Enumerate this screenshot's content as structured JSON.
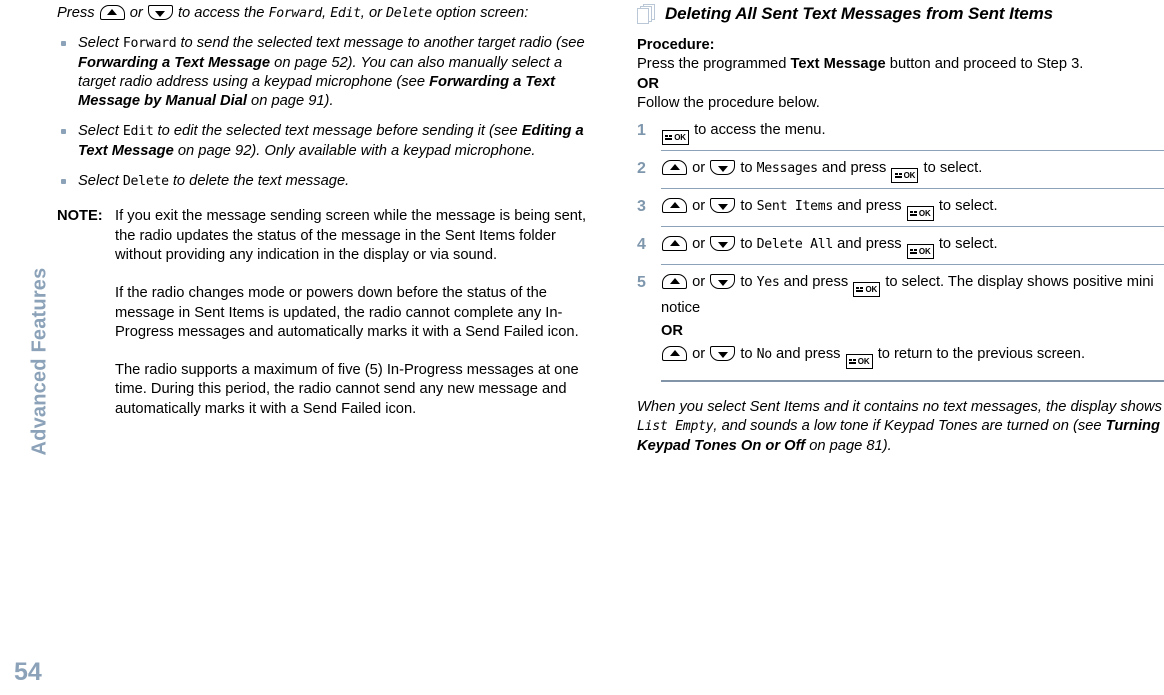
{
  "sidebar": {
    "chapter_title": "Advanced Features",
    "page_number": "54",
    "accent_color": "#8ba2b8"
  },
  "left_column": {
    "intro": {
      "text_a": "Press ",
      "text_b": " or ",
      "text_c": " to access the ",
      "lcd_forward": "Forward",
      "text_d": ", ",
      "lcd_edit": "Edit",
      "text_e": ", or ",
      "lcd_delete": "Delete",
      "text_f": " option screen:"
    },
    "bullets": [
      {
        "select_word": "Select ",
        "lcd": "Forward",
        "body_1": " to send the selected text message to another target radio (see ",
        "bold_1": "Forwarding a Text Message",
        "body_2": " on page 52). You can also manually select a target radio address using a keypad microphone (see ",
        "bold_2": "Forwarding a Text Message by Manual Dial",
        "body_3": " on page 91)."
      },
      {
        "select_word": "Select ",
        "lcd": "Edit",
        "body_1": " to edit the selected text message before sending it (see ",
        "bold_1": "Editing a Text Message",
        "body_2": " on page 92). Only available with a keypad microphone.",
        "bold_2": "",
        "body_3": ""
      },
      {
        "select_word": "Select ",
        "lcd": "Delete",
        "body_1": " to delete the text message.",
        "bold_1": "",
        "body_2": "",
        "bold_2": "",
        "body_3": ""
      }
    ],
    "note": {
      "label": "NOTE:",
      "paragraphs": [
        "If you exit the message sending screen while the message is being sent, the radio updates the status of the message in the Sent Items folder without providing any indication in the display or via sound.",
        "If the radio changes mode or powers down before the status of the message in Sent Items is updated, the radio cannot complete any In-Progress messages and automatically marks it with a Send Failed icon.",
        "The radio supports a maximum of five (5) In-Progress messages at one time. During this period, the radio cannot send any new message and automatically marks it with a Send Failed icon."
      ]
    }
  },
  "right_column": {
    "section_title": "Deleting All Sent Text Messages from Sent Items",
    "procedure_label": "Procedure:",
    "intro_a": "Press the programmed ",
    "intro_bold": "Text Message",
    "intro_b": " button and proceed to Step 3.",
    "or_label": "OR",
    "intro_c": "Follow the procedure below.",
    "steps": [
      {
        "num": "1",
        "pre": "",
        "keys": "menu",
        "text_a": " to access the menu.",
        "lcd": "",
        "text_b": "",
        "text_c": ""
      },
      {
        "num": "2",
        "pre": "",
        "keys": "updown",
        "text_a": " to ",
        "lcd": "Messages",
        "text_b": " and press ",
        "text_c": " to select."
      },
      {
        "num": "3",
        "pre": "",
        "keys": "updown",
        "text_a": " to ",
        "lcd": "Sent Items",
        "text_b": " and press ",
        "text_c": " to select."
      },
      {
        "num": "4",
        "pre": "",
        "keys": "updown",
        "text_a": " to ",
        "lcd": "Delete All",
        "text_b": " and press ",
        "text_c": " to select."
      }
    ],
    "step5": {
      "num": "5",
      "text_a": " to ",
      "lcd_yes": "Yes",
      "text_b": " and press ",
      "text_c": " to select. The display shows positive mini notice",
      "or_label": "OR",
      "text_d": " to ",
      "lcd_no": "No",
      "text_e": " and press ",
      "text_f": " to return to the previous screen."
    },
    "footer_note": {
      "text_a": "When you select Sent Items and it contains no text messages, the display shows ",
      "lcd": "List Empty",
      "text_b": ", and sounds a low tone if Keypad Tones are turned on (see ",
      "bold": "Turning Keypad Tones On or Off",
      "text_c": " on page 81)."
    }
  },
  "icons": {
    "up_key": "up-arrow-key",
    "down_key": "down-arrow-key",
    "menu_key": "menu-ok-key",
    "section": "stacked-pages-icon"
  }
}
